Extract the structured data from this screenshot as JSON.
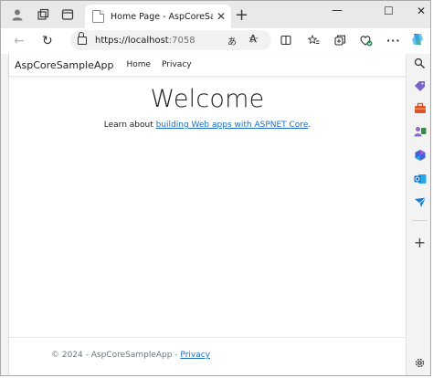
{
  "browser": {
    "tab_title": "Home Page - AspCoreSampleApp",
    "tab_close": "✕",
    "new_tab": "+",
    "url_host": "https://localhost",
    "url_port": ":7058",
    "window_controls": {
      "minimize": "—",
      "maximize": "☐",
      "close": "✕"
    }
  },
  "site": {
    "brand": "AspCoreSampleApp",
    "nav": [
      "Home",
      "Privacy"
    ],
    "heading": "Welcome",
    "learn_prefix": "Learn about ",
    "learn_link": "building Web apps with ASPNET Core",
    "learn_suffix": ".",
    "footer_text": "© 2024 - AspCoreSampleApp - ",
    "footer_link": "Privacy"
  },
  "icons": {
    "profile": "profile-icon",
    "workspaces": "workspaces-icon",
    "tab_actions": "tab-actions-icon",
    "back": "back-icon",
    "refresh": "refresh-icon",
    "read_aloud": "read-aloud-icon",
    "favorite": "star-icon",
    "split": "split-screen-icon",
    "favorites": "favorites-icon",
    "collections": "collections-icon",
    "browser_essentials": "heart-icon",
    "more": "more-icon",
    "copilot": "copilot-icon"
  },
  "sidebar_items": [
    "search-icon",
    "shopping-icon",
    "tools-icon",
    "games-icon",
    "microsoft365-icon",
    "outlook-icon",
    "send-icon",
    "add-icon",
    "settings-icon"
  ]
}
